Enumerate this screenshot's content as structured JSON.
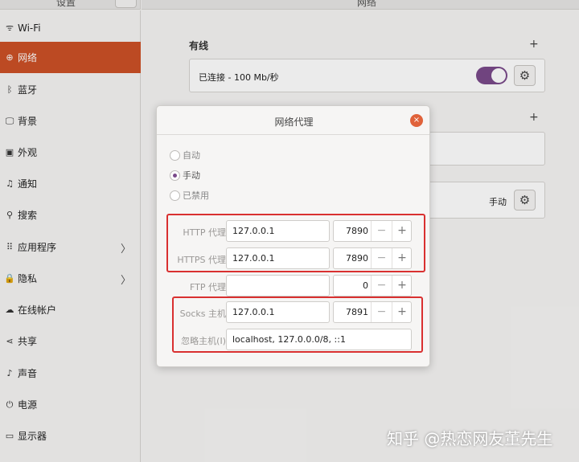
{
  "sidebar_header": {
    "title": "设置",
    "menu_icon": "hamburger-icon",
    "menu_glyph": "≡"
  },
  "main_header": {
    "title": "网络"
  },
  "sidebar": {
    "items": [
      {
        "icon": "wifi-icon",
        "glyph": "ᯤ",
        "label": "Wi-Fi"
      },
      {
        "icon": "network-icon",
        "glyph": "⊕",
        "label": "网络",
        "active": true
      },
      {
        "icon": "bluetooth-icon",
        "glyph": "ᛒ",
        "label": "蓝牙"
      },
      {
        "icon": "background-icon",
        "glyph": "🖵",
        "label": "背景"
      },
      {
        "icon": "appearance-icon",
        "glyph": "▣",
        "label": "外观"
      },
      {
        "icon": "bell-icon",
        "glyph": "♫",
        "label": "通知"
      },
      {
        "icon": "search-icon",
        "glyph": "⚲",
        "label": "搜索"
      },
      {
        "icon": "apps-grid-icon",
        "glyph": "⠿",
        "label": "应用程序",
        "chevron": "〉"
      },
      {
        "icon": "lock-icon",
        "glyph": "🔒",
        "label": "隐私",
        "chevron": "〉"
      },
      {
        "icon": "cloud-icon",
        "glyph": "☁",
        "label": "在线帐户"
      },
      {
        "icon": "share-icon",
        "glyph": "⋖",
        "label": "共享"
      },
      {
        "icon": "music-icon",
        "glyph": "♪",
        "label": "声音"
      },
      {
        "icon": "power-icon",
        "glyph": "⏻",
        "label": "电源"
      },
      {
        "icon": "display-icon",
        "glyph": "▭",
        "label": "显示器"
      }
    ]
  },
  "main": {
    "wired": {
      "title": "有线",
      "plus": "+",
      "status": "已连接 - 100 Mb/秒",
      "toggle_on": true,
      "gear_glyph": "⚙"
    },
    "vpn_plus": "+",
    "proxy": {
      "mode": "手动",
      "gear_glyph": "⚙"
    }
  },
  "dialog": {
    "title": "网络代理",
    "close_glyph": "×",
    "modes": [
      {
        "label": "自动",
        "selected": false
      },
      {
        "label": "手动",
        "selected": true
      },
      {
        "label": "已禁用",
        "selected": false
      }
    ],
    "rows": [
      {
        "label": "HTTP 代理",
        "host": "127.0.0.1",
        "port": "7890"
      },
      {
        "label": "HTTPS 代理",
        "host": "127.0.0.1",
        "port": "7890"
      },
      {
        "label": "FTP 代理",
        "host": "",
        "port": "0"
      },
      {
        "label": "Socks 主机",
        "host": "127.0.0.1",
        "port": "7891"
      }
    ],
    "ignore": {
      "label": "忽略主机(I)",
      "value": "localhost, 127.0.0.0/8, ::1"
    },
    "minus_glyph": "−",
    "plus_glyph": "+"
  },
  "watermark": "知乎 @热恋网友董先生",
  "colors": {
    "accent": "#cc5126",
    "toggle": "#7a4a8a",
    "highlight_box": "#d93030",
    "close": "#e0623a"
  }
}
